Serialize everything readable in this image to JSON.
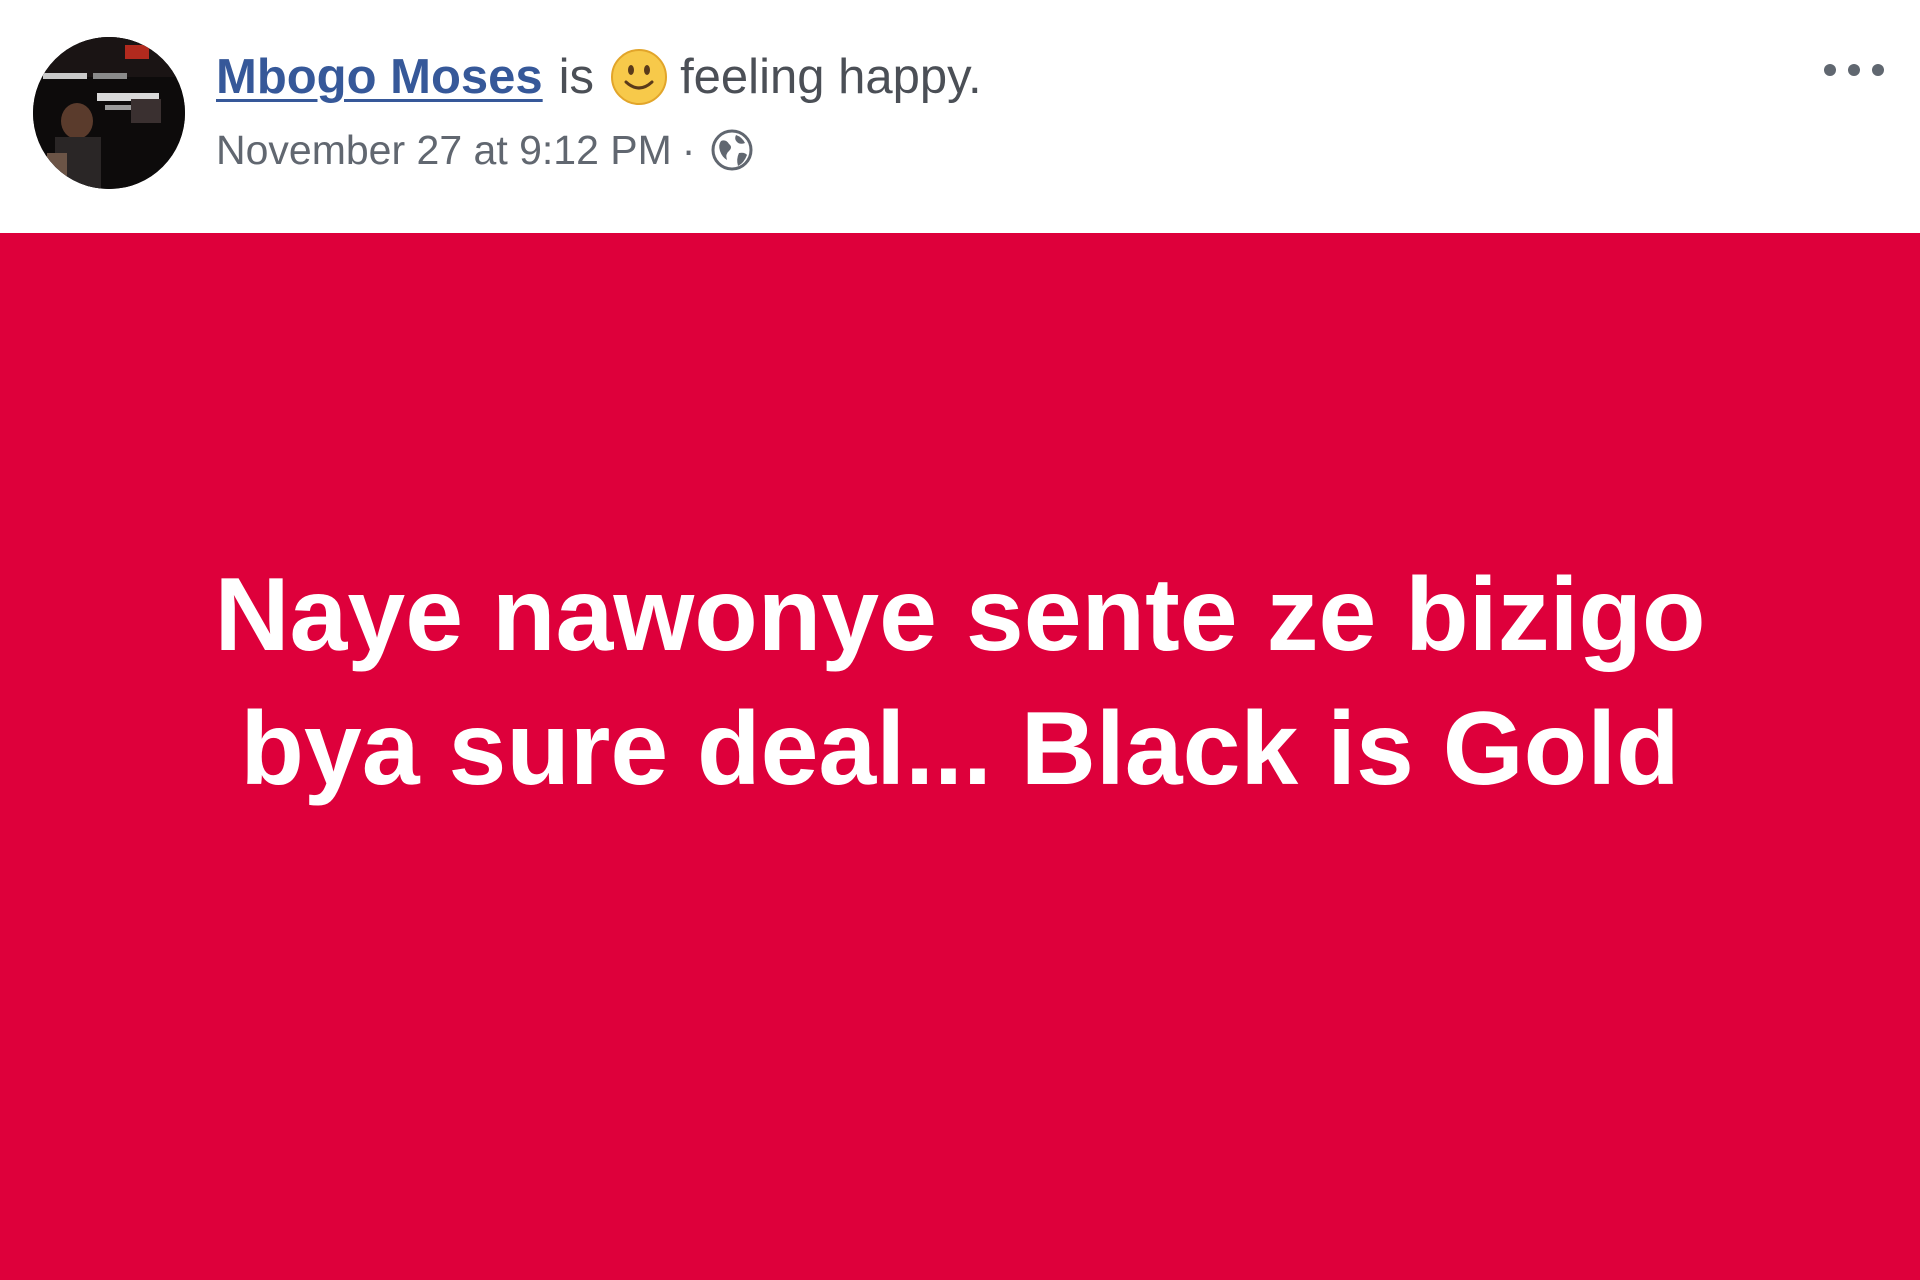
{
  "post": {
    "author_name": "Mbogo Moses",
    "verb": "is",
    "feeling_icon": "smiley-emoji-icon",
    "feeling_text": "feeling happy.",
    "timestamp": "November 27 at 9:12 PM",
    "separator": "·",
    "privacy_icon": "globe-icon",
    "more_icon": "more-options-icon",
    "text_lines": [
      "Naye nawonye sente ze bizigo",
      "bya sure deal... Black is Gold"
    ],
    "background_color": "#de003b",
    "text_color": "#ffffff",
    "author_color": "#365899"
  }
}
